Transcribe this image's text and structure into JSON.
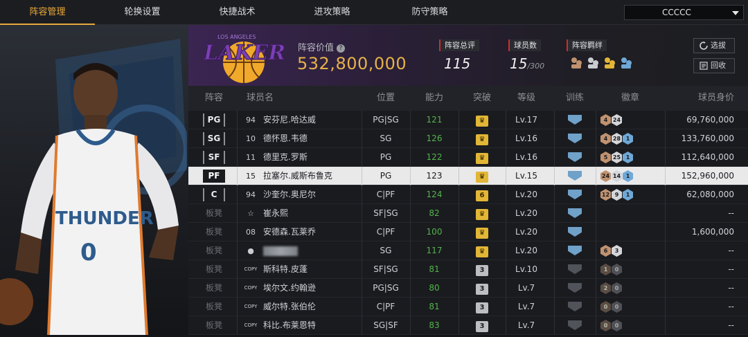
{
  "tabs": [
    {
      "label": "阵容管理",
      "active": true
    },
    {
      "label": "轮换设置",
      "active": false
    },
    {
      "label": "快捷战术",
      "active": false
    },
    {
      "label": "进攻策略",
      "active": false
    },
    {
      "label": "防守策略",
      "active": false
    }
  ],
  "team_select": {
    "value": "CCCCC"
  },
  "header": {
    "team_logo_text": "LAKERS",
    "team_logo_subtext": "LOS ANGELES",
    "value_label": "阵容价值",
    "value": "532,800,000",
    "overall_label": "阵容总评",
    "overall": "115",
    "players_label": "球员数",
    "players": "15",
    "players_max": "/300",
    "bonds_label": "阵容羁绊",
    "select_btn": "选拔",
    "recycle_btn": "回收"
  },
  "columns": [
    "阵容",
    "球员名",
    "位置",
    "能力",
    "突破",
    "等级",
    "训练",
    "徽章",
    "球员身价"
  ],
  "rows": [
    {
      "slot": "PG",
      "num": "94",
      "name": "安芬尼.哈达威",
      "pos": "PG|SG",
      "ability": "121",
      "breakthrough": "gold",
      "level": "Lv.17",
      "train": "blue",
      "badges": [
        {
          "t": "bronze",
          "v": "4"
        },
        {
          "t": "silver",
          "v": "24"
        }
      ],
      "price": "69,760,000",
      "selected": false
    },
    {
      "slot": "SG",
      "num": "10",
      "name": "德怀恩.韦德",
      "pos": "SG",
      "ability": "126",
      "breakthrough": "gold",
      "level": "Lv.16",
      "train": "blue",
      "badges": [
        {
          "t": "bronze",
          "v": "4"
        },
        {
          "t": "silver",
          "v": "28"
        },
        {
          "t": "blue",
          "v": "1"
        }
      ],
      "price": "133,760,000",
      "selected": false
    },
    {
      "slot": "SF",
      "num": "11",
      "name": "德里克.罗斯",
      "pos": "PG",
      "ability": "122",
      "breakthrough": "gold",
      "level": "Lv.16",
      "train": "blue",
      "badges": [
        {
          "t": "bronze",
          "v": "5"
        },
        {
          "t": "silver",
          "v": "25"
        },
        {
          "t": "blue",
          "v": "1"
        }
      ],
      "price": "112,640,000",
      "selected": false
    },
    {
      "slot": "PF",
      "num": "15",
      "name": "拉塞尔.威斯布鲁克",
      "pos": "PG",
      "ability": "123",
      "breakthrough": "gold",
      "level": "Lv.15",
      "train": "blue",
      "badges": [
        {
          "t": "bronze",
          "v": "24"
        },
        {
          "t": "silver",
          "v": "14"
        },
        {
          "t": "blue",
          "v": "1"
        }
      ],
      "price": "152,960,000",
      "selected": true
    },
    {
      "slot": "C",
      "num": "94",
      "name": "沙奎尔.奥尼尔",
      "pos": "C|PF",
      "ability": "124",
      "breakthrough": "6",
      "level": "Lv.20",
      "train": "blue",
      "badges": [
        {
          "t": "bronze",
          "v": "12"
        },
        {
          "t": "silver",
          "v": "9"
        },
        {
          "t": "blue",
          "v": "1"
        }
      ],
      "price": "62,080,000",
      "selected": false
    },
    {
      "slot": "板凳",
      "num": "☆",
      "name": "崔永熙",
      "pos": "SF|SG",
      "ability": "82",
      "breakthrough": "gold",
      "level": "Lv.20",
      "train": "blue",
      "badges": [],
      "price": "--",
      "selected": false
    },
    {
      "slot": "板凳",
      "num": "08",
      "name": "安德森.瓦莱乔",
      "pos": "C|PF",
      "ability": "100",
      "breakthrough": "gold",
      "level": "Lv.20",
      "train": "blue",
      "badges": [],
      "price": "1,600,000",
      "selected": false
    },
    {
      "slot": "板凳",
      "num": "",
      "name": "",
      "pos": "SG",
      "ability": "117",
      "breakthrough": "gold",
      "level": "Lv.20",
      "train": "blue",
      "badges": [
        {
          "t": "bronze",
          "v": "6"
        },
        {
          "t": "silver",
          "v": "3"
        }
      ],
      "price": "--",
      "selected": false
    },
    {
      "slot": "板凳",
      "num": "COPY",
      "name": "斯科特.皮蓬",
      "pos": "SF|SG",
      "ability": "81",
      "breakthrough": "3",
      "level": "Lv.10",
      "train": "dark",
      "badges": [
        {
          "t": "dim",
          "v": "1"
        },
        {
          "t": "dimgrey",
          "v": "0"
        }
      ],
      "price": "--",
      "selected": false
    },
    {
      "slot": "板凳",
      "num": "COPY",
      "name": "埃尔文.约翰逊",
      "pos": "PG|SG",
      "ability": "80",
      "breakthrough": "3",
      "level": "Lv.7",
      "train": "dark",
      "badges": [
        {
          "t": "dim",
          "v": "2"
        },
        {
          "t": "dimgrey",
          "v": "0"
        }
      ],
      "price": "--",
      "selected": false
    },
    {
      "slot": "板凳",
      "num": "COPY",
      "name": "威尔特.张伯伦",
      "pos": "C|PF",
      "ability": "81",
      "breakthrough": "3",
      "level": "Lv.7",
      "train": "dark",
      "badges": [
        {
          "t": "dim",
          "v": "0"
        },
        {
          "t": "dimgrey",
          "v": "0"
        }
      ],
      "price": "--",
      "selected": false
    },
    {
      "slot": "板凳",
      "num": "COPY",
      "name": "科比.布莱恩特",
      "pos": "SG|SF",
      "ability": "83",
      "breakthrough": "3",
      "level": "Lv.7",
      "train": "dark",
      "badges": [
        {
          "t": "dim",
          "v": "0"
        },
        {
          "t": "dimgrey",
          "v": "0"
        }
      ],
      "price": "--",
      "selected": false
    }
  ],
  "left_art": {
    "jersey_text": "THUNDER",
    "jersey_number": "0"
  },
  "colors": {
    "accent": "#e8a93a",
    "value": "#e6b24a",
    "green": "#52b54a",
    "lakers_purple": "#552583",
    "lakers_gold": "#fdb927"
  }
}
